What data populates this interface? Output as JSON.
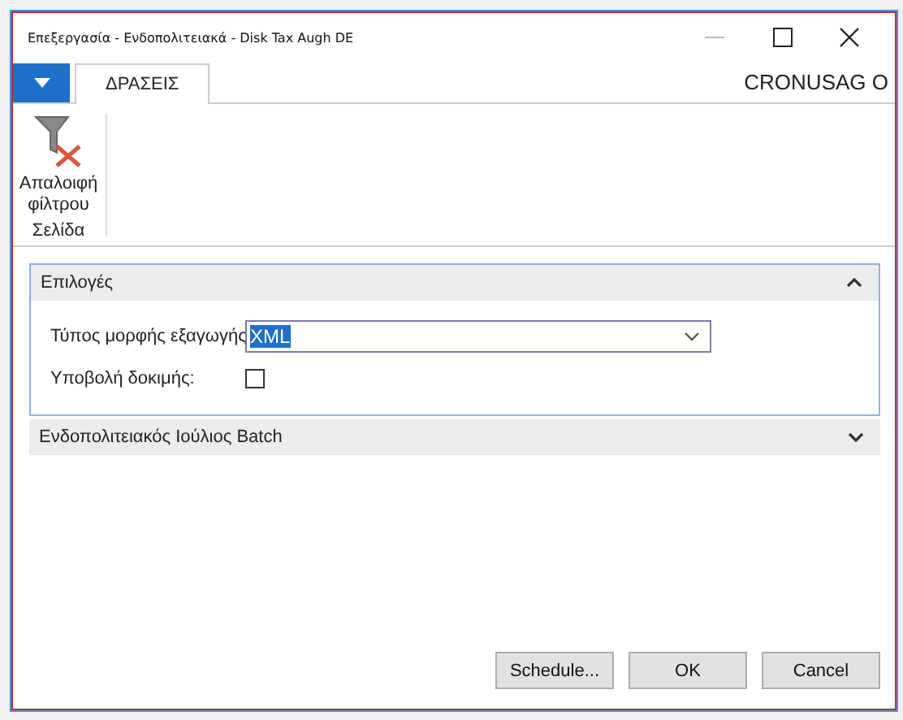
{
  "window": {
    "title": "Επεξεργασία - Ενδοπολιτειακά - Disk Tax Augh DE"
  },
  "tabs": [
    {
      "label": "ΔΡΑΣΕΙΣ",
      "selected": true
    }
  ],
  "company": "CRONUSAG O",
  "ribbon": {
    "groups": [
      {
        "label": "Σελίδα",
        "actions": [
          {
            "label": "Απαλοιφή φίλτρου"
          }
        ]
      }
    ]
  },
  "sections": [
    {
      "title": "Επιλογές",
      "expanded": true,
      "fields": [
        {
          "kind": "dropdown",
          "label": "Τύπος μορφής εξαγωγής",
          "value": "XML"
        },
        {
          "kind": "checkbox",
          "label": "Υποβολή δοκιμής:",
          "checked": false
        }
      ]
    },
    {
      "title": "Ενδοπολιτειακός Ιούλιος Batch",
      "expanded": false
    }
  ],
  "buttons": [
    "Schedule...",
    "OK",
    "Cancel"
  ]
}
